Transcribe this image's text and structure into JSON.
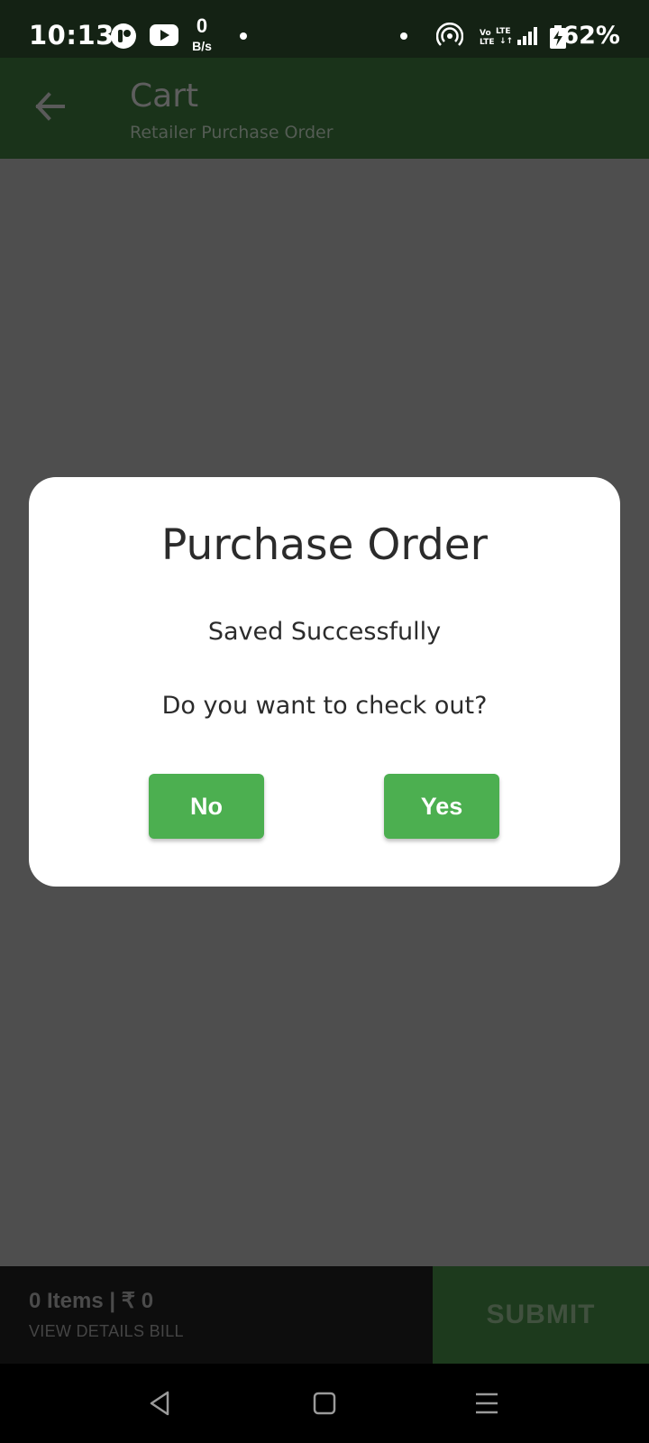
{
  "status_bar": {
    "time": "10:13",
    "net_speed_value": "0",
    "net_speed_unit": "B/s",
    "battery": "62%",
    "icons": [
      "app-notification-icon",
      "youtube-icon",
      "hotspot-icon",
      "volte-icon",
      "lte-signal-icon",
      "battery-charging-icon"
    ]
  },
  "app_bar": {
    "title": "Cart",
    "subtitle": "Retailer Purchase Order",
    "back_icon": "arrow-left-icon"
  },
  "dialog": {
    "title": "Purchase Order",
    "message": "Saved Successfully",
    "question": "Do you want to check out?",
    "no_label": "No",
    "yes_label": "Yes"
  },
  "bottom_bar": {
    "summary": "0 Items | ₹ 0",
    "details_link": "VIEW DETAILS BILL",
    "submit_label": "SUBMIT"
  },
  "nav_bar": {
    "icons": [
      "back-triangle-icon",
      "home-square-icon",
      "menu-lines-icon"
    ]
  },
  "colors": {
    "accent_green": "#4caf50",
    "app_bar_bg": "#1a331a",
    "scrim": "#4e4e4e"
  }
}
